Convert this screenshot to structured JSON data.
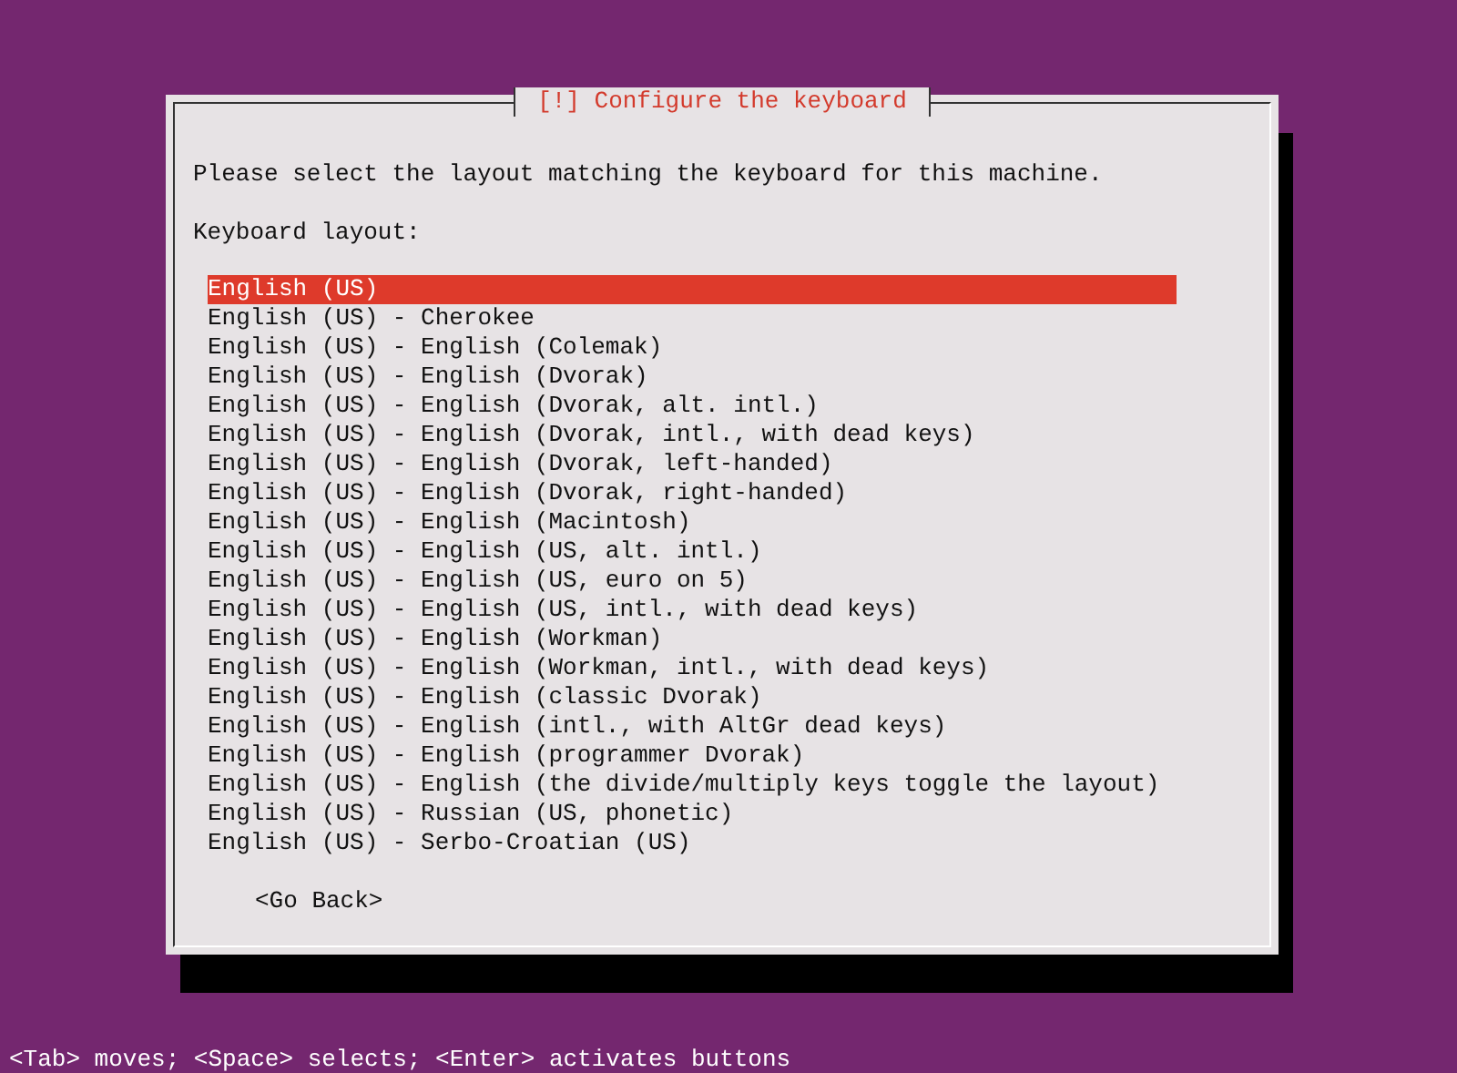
{
  "dialog": {
    "title": "[!] Configure the keyboard",
    "prompt": "Please select the layout matching the keyboard for this machine.",
    "list_label": "Keyboard layout:",
    "layouts": [
      {
        "label": "English (US)",
        "selected": true
      },
      {
        "label": "English (US) - Cherokee",
        "selected": false
      },
      {
        "label": "English (US) - English (Colemak)",
        "selected": false
      },
      {
        "label": "English (US) - English (Dvorak)",
        "selected": false
      },
      {
        "label": "English (US) - English (Dvorak, alt. intl.)",
        "selected": false
      },
      {
        "label": "English (US) - English (Dvorak, intl., with dead keys)",
        "selected": false
      },
      {
        "label": "English (US) - English (Dvorak, left-handed)",
        "selected": false
      },
      {
        "label": "English (US) - English (Dvorak, right-handed)",
        "selected": false
      },
      {
        "label": "English (US) - English (Macintosh)",
        "selected": false
      },
      {
        "label": "English (US) - English (US, alt. intl.)",
        "selected": false
      },
      {
        "label": "English (US) - English (US, euro on 5)",
        "selected": false
      },
      {
        "label": "English (US) - English (US, intl., with dead keys)",
        "selected": false
      },
      {
        "label": "English (US) - English (Workman)",
        "selected": false
      },
      {
        "label": "English (US) - English (Workman, intl., with dead keys)",
        "selected": false
      },
      {
        "label": "English (US) - English (classic Dvorak)",
        "selected": false
      },
      {
        "label": "English (US) - English (intl., with AltGr dead keys)",
        "selected": false
      },
      {
        "label": "English (US) - English (programmer Dvorak)",
        "selected": false
      },
      {
        "label": "English (US) - English (the divide/multiply keys toggle the layout)",
        "selected": false
      },
      {
        "label": "English (US) - Russian (US, phonetic)",
        "selected": false
      },
      {
        "label": "English (US) - Serbo-Croatian (US)",
        "selected": false
      }
    ],
    "back_button": "<Go Back>"
  },
  "status_bar": "<Tab> moves; <Space> selects; <Enter> activates buttons"
}
